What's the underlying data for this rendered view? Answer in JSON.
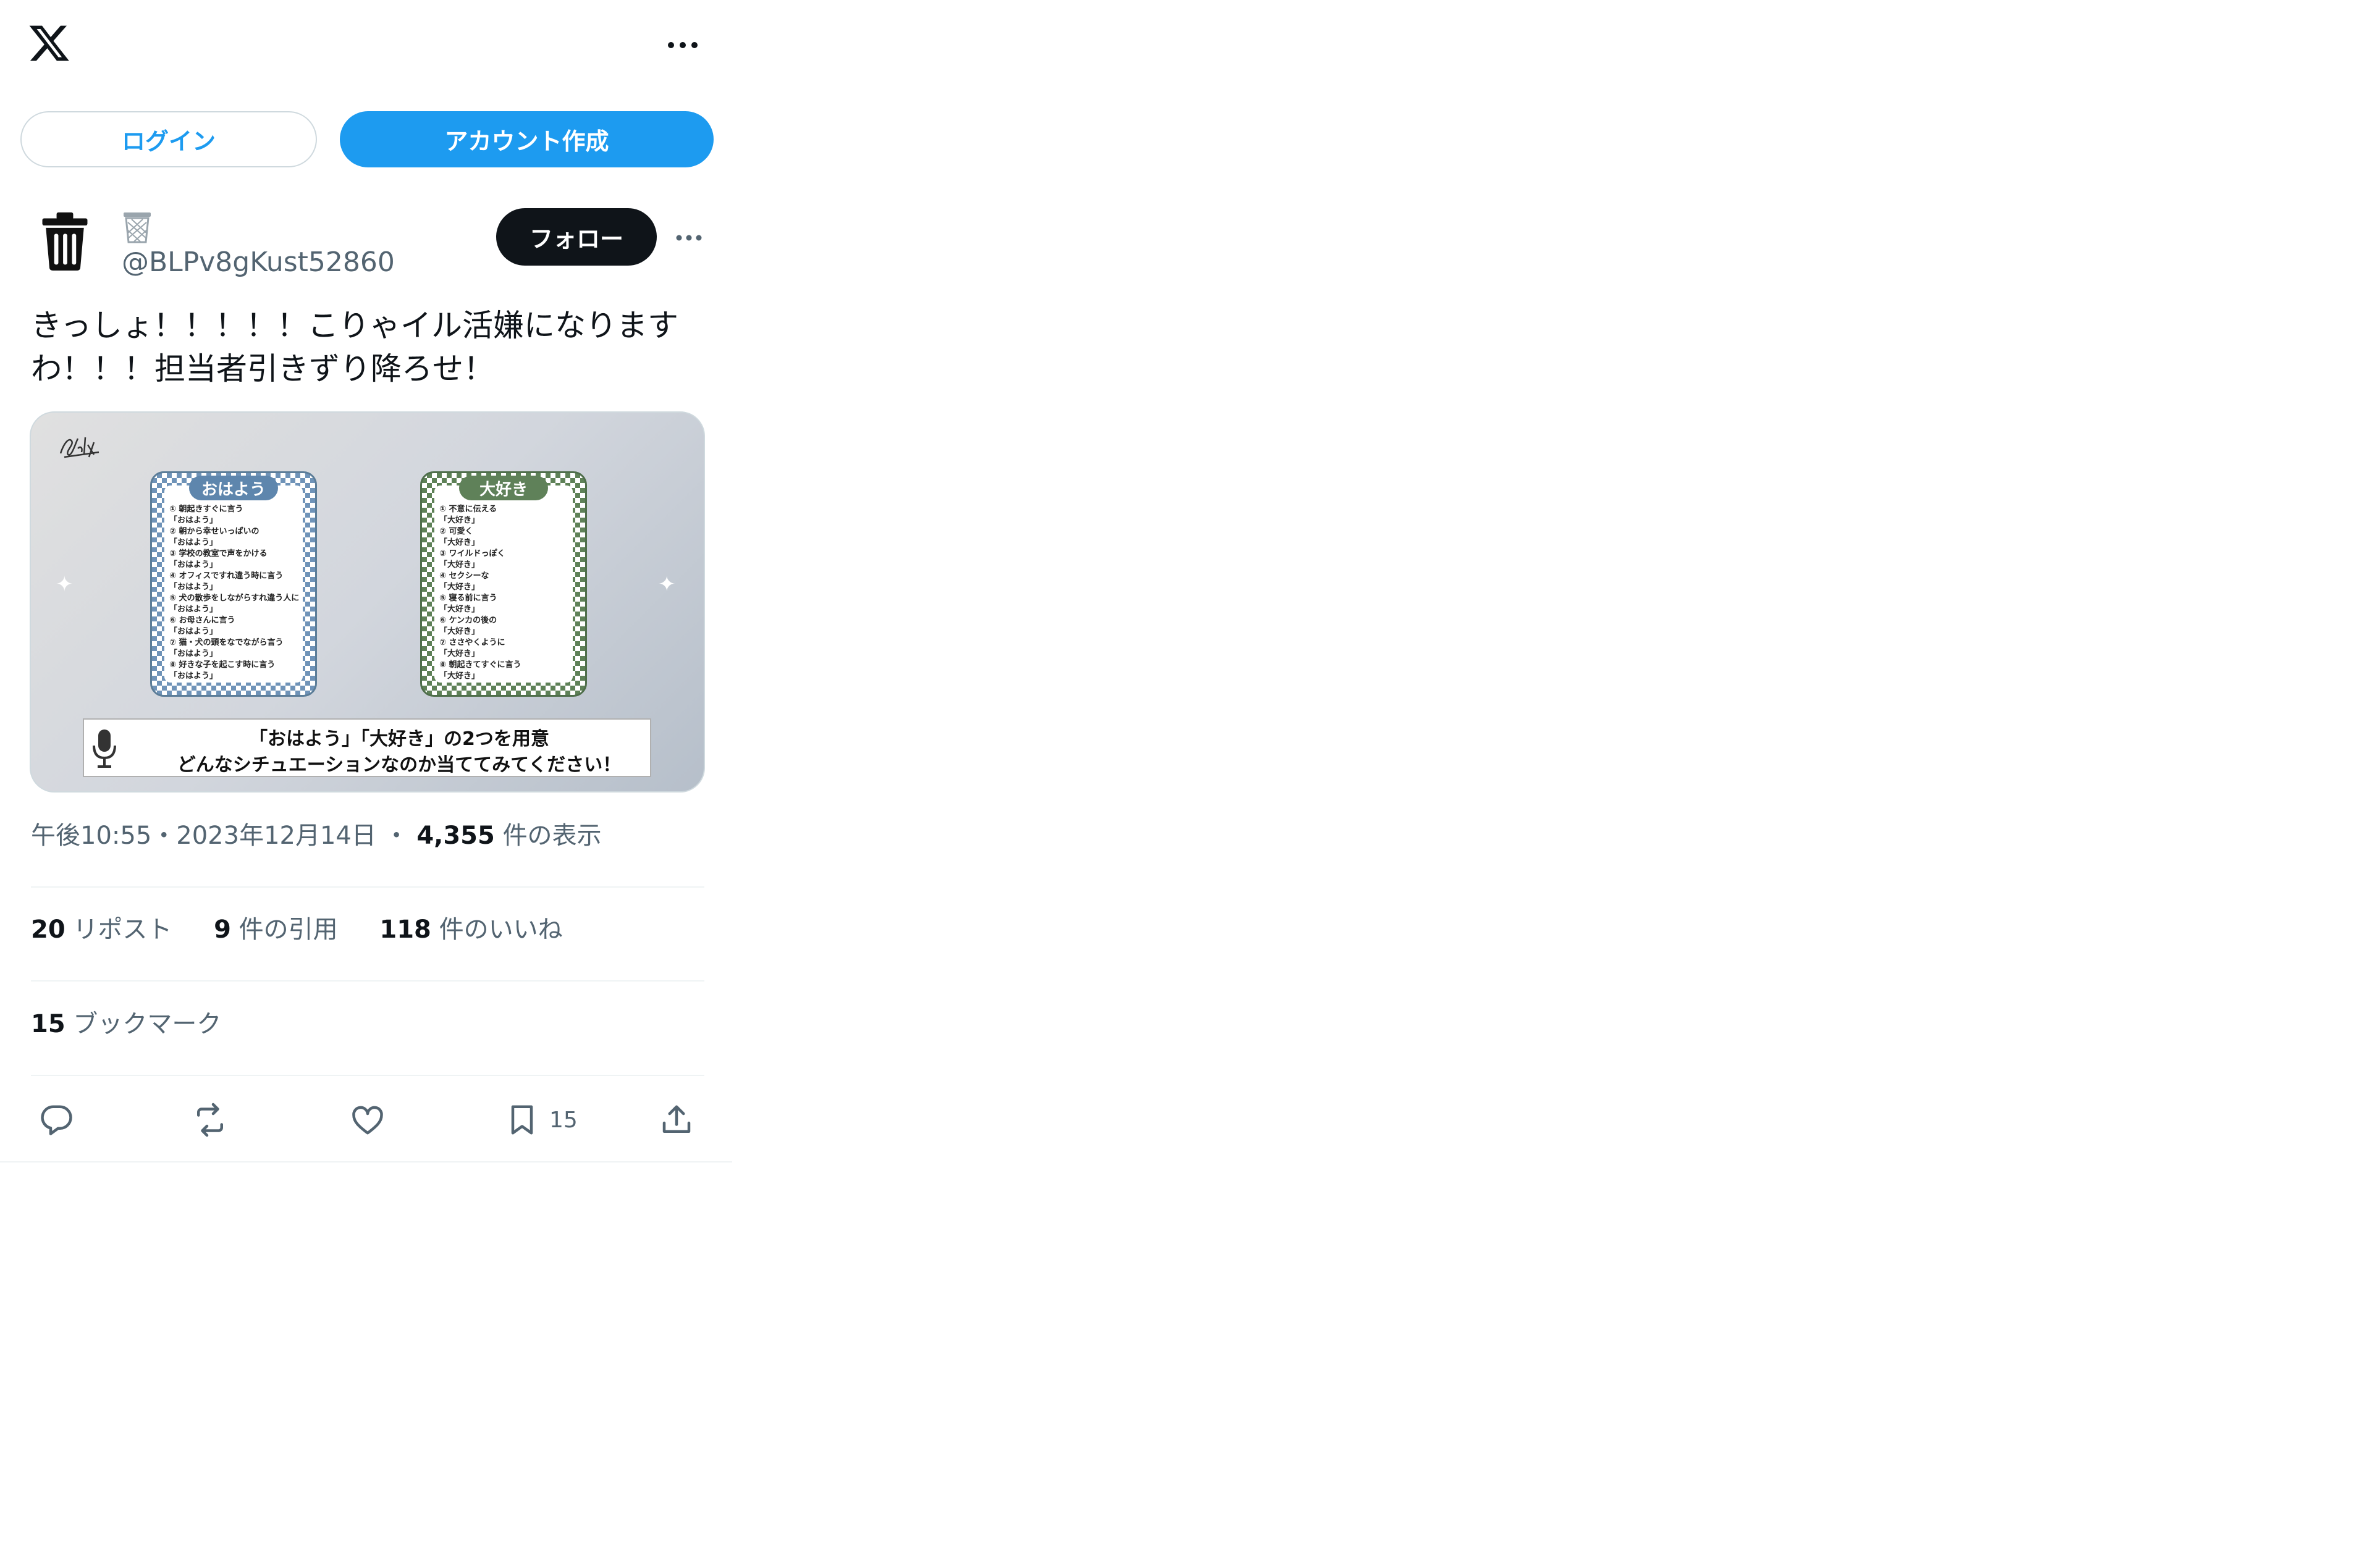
{
  "header": {
    "logo_icon": "x-logo-icon",
    "more_icon": "more-horizontal-icon"
  },
  "auth": {
    "login_label": "ログイン",
    "signup_label": "アカウント作成"
  },
  "post": {
    "avatar_icon": "trash-icon",
    "display_name_icon": "wastebasket-emoji",
    "handle": "@BLPv8gKust52860",
    "follow_label": "フォロー",
    "text": "きっしょ！！！！！こりゃイル活嫌になりますわ！！！担当者引きずり降ろせ！",
    "image": {
      "card_left": {
        "title": "おはよう",
        "lines": [
          "① 朝起きすぐに言う",
          "「おはよう」",
          "② 朝から幸せいっぱいの",
          "「おはよう」",
          "③ 学校の教室で声をかける",
          "「おはよう」",
          "④ オフィスですれ違う時に言う",
          "「おはよう」",
          "⑤ 犬の散歩をしながらすれ違う人に",
          "「おはよう」",
          "⑥ お母さんに言う",
          "「おはよう」",
          "⑦ 猫・犬の頭をなでながら言う",
          "「おはよう」",
          "⑧ 好きな子を起こす時に言う",
          "「おはよう」"
        ]
      },
      "card_right": {
        "title": "大好き",
        "lines": [
          "① 不意に伝える",
          "「大好き」",
          "② 可愛く",
          "「大好き」",
          "③ ワイルドっぽく",
          "「大好き」",
          "④ セクシーな",
          "「大好き」",
          "⑤ 寝る前に言う",
          "「大好き」",
          "⑥ ケンカの後の",
          "「大好き」",
          "⑦ ささやくように",
          "「大好き」",
          "⑧ 朝起きてすぐに言う",
          "「大好き」"
        ]
      },
      "caption_line1": "「おはよう」「大好き」の2つを用意",
      "caption_line2": "どんなシチュエーションなのか当ててみてください！"
    },
    "meta": {
      "time": "午後10:55",
      "sep1": "・",
      "date": "2023年12月14日",
      "sep2": "・",
      "views": "4,355",
      "views_label": "件の表示"
    },
    "stats": {
      "reposts": "20",
      "reposts_label": "リポスト",
      "quotes": "9",
      "quotes_label": "件の引用",
      "likes": "118",
      "likes_label": "件のいいね"
    },
    "bookmarks": {
      "count": "15",
      "label": "ブックマーク"
    },
    "actions": {
      "reply_icon": "reply-icon",
      "repost_icon": "repost-icon",
      "like_icon": "heart-icon",
      "bookmark_icon": "bookmark-icon",
      "bookmark_count": "15",
      "share_icon": "share-icon"
    }
  }
}
